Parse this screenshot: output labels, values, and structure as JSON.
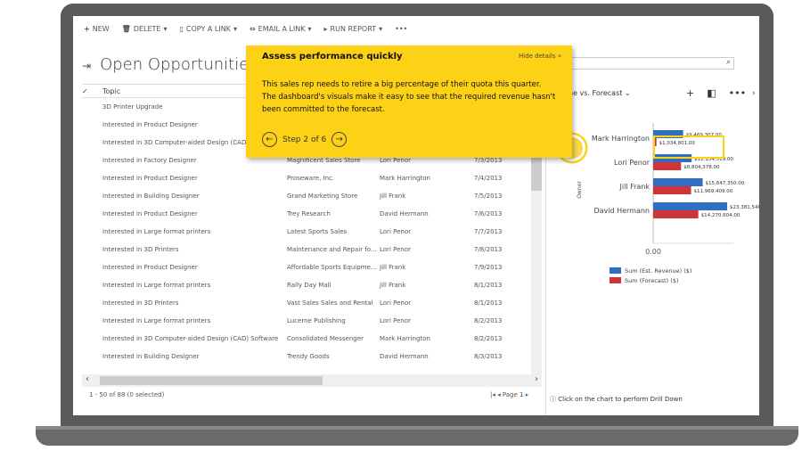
{
  "toolbar": {
    "new": "NEW",
    "delete": "DELETE",
    "copy_link": "COPY A LINK",
    "email_link": "EMAIL A LINK",
    "run_report": "RUN REPORT",
    "more": "•••"
  },
  "page_title": "Open Opportunities",
  "grid": {
    "header_topic": "Topic",
    "rows": [
      [
        "3D Printer Upgrade",
        "",
        "",
        ""
      ],
      [
        "Interested in Product Designer",
        "",
        "",
        ""
      ],
      [
        "Interested in 3D Computer-aided Design (CAD) S",
        "",
        "",
        ""
      ],
      [
        "Interested in Factory Designer",
        "Magnificent Sales Store",
        "Lori Penor",
        "7/3/2013"
      ],
      [
        "Interested in Product Designer",
        "Proseware, Inc.",
        "Mark Harrington",
        "7/4/2013"
      ],
      [
        "Interested in Building Designer",
        "Grand Marketing Store",
        "Jill Frank",
        "7/5/2013"
      ],
      [
        "Interested in Product Designer",
        "Trey Research",
        "David Hermann",
        "7/6/2013"
      ],
      [
        "Interested in Large format printers",
        "Latest Sports Sales",
        "Lori Penor",
        "7/7/2013"
      ],
      [
        "Interested in 3D Printers",
        "Maintenance and Repair fo...",
        "Lori Penor",
        "7/8/2013"
      ],
      [
        "Interested in Product Designer",
        "Affordable Sports Equipme...",
        "Jill Frank",
        "7/9/2013"
      ],
      [
        "Interested in Large format printers",
        "Rally Day Mall",
        "Jill Frank",
        "8/1/2013"
      ],
      [
        "Interested in 3D Printers",
        "Vast Sales Sales and Rental",
        "Lori Penor",
        "8/1/2013"
      ],
      [
        "Interested in Large format printers",
        "Lucerne Publishing",
        "Lori Penor",
        "8/2/2013"
      ],
      [
        "Interested in 3D Computer-aided Design (CAD) Software",
        "Consolidated Messenger",
        "Mark Harrington",
        "8/2/2013"
      ],
      [
        "Interested in Building Designer",
        "Trendy Goods",
        "David Hermann",
        "8/3/2013"
      ]
    ],
    "footer": "1 - 50 of 88 (0 selected)",
    "page": "Page 1"
  },
  "chart": {
    "title": "ne vs. Forecast",
    "drill": "Click on the chart to perform Drill Down"
  },
  "chart_data": {
    "type": "bar",
    "orientation": "horizontal",
    "ylabel": "Owner",
    "x_tick": "0.00",
    "categories": [
      "Mark Harrington",
      "Lori Penor",
      "Jill Frank",
      "David Hermann"
    ],
    "series": [
      {
        "name": "Sum (Est. Revenue) ($)",
        "color": "#2e6fc4",
        "values": [
          9469307,
          12154519,
          15647350,
          23381546
        ],
        "labels": [
          "$9,469,307.00",
          "$12,154,519.00",
          "$15,647,350.00",
          "$23,381,546.00"
        ]
      },
      {
        "name": "Sum (Forecast) ($)",
        "color": "#d03434",
        "values": [
          1034801,
          8804378,
          11969409,
          14270604
        ],
        "labels": [
          "$1,034,801.00",
          "$8,804,378.00",
          "$11,969,409.00",
          "$14,270,604.00"
        ]
      }
    ],
    "legend": "bottom"
  },
  "tour": {
    "title": "Assess performance quickly",
    "hide": "Hide details »",
    "body": "This sales rep needs to retire a big percentage of their quota this quarter. The dashboard's visuals make it easy to see that the required revenue hasn't been committed to the forecast.",
    "step": "Step 2 of 6"
  }
}
